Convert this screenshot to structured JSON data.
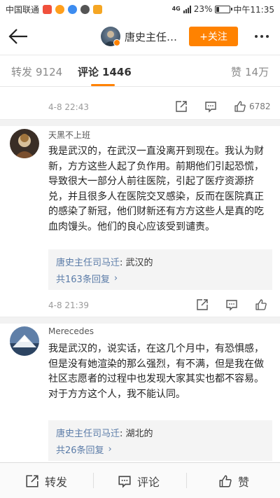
{
  "status_bar": {
    "carrier": "中国联通",
    "network": "4G",
    "battery_percent": "23%",
    "battery_level": 0.23,
    "time": "中午11:35"
  },
  "header": {
    "author_name": "唐史主任…",
    "follow_label": "+关注"
  },
  "tabs": {
    "repost_label": "转发",
    "repost_count": "9124",
    "comment_label": "评论",
    "comment_count": "1446",
    "like_label": "赞",
    "like_count": "14万"
  },
  "previous_comment_meta": {
    "time": "4-8 22:43",
    "like_count": "6782"
  },
  "comments": [
    {
      "username": "天黑不上班",
      "text": "我是武汉的，在武汉一直没离开到现在。我认为财新，方方这些人起了负作用。前期他们引起恐慌，导致很大一部分人前往医院，引起了医疗资源挤兑，并且很多人在医院交叉感染，反而在医院真正的感染了新冠，他们财新还有方方这些人是真的吃血肉馒头。他们的良心应该受到谴责。",
      "reply_author": "唐史主任司马迁",
      "reply_text": "武汉的",
      "reply_count_text": "共163条回复",
      "time": "4-8 21:39"
    },
    {
      "username": "Merecedes",
      "text": "我是武汉的，说实话，在这几个月中，有恐惧感，但是没有她渲染的那么强烈，有不满，但是我在做社区志愿者的过程中也发现大家其实也都不容易。对于方方这个人，我不能认同。",
      "reply_author": "唐史主任司马迁",
      "reply_text": "湖北的",
      "reply_count_text": "共26条回复"
    }
  ],
  "bottom_bar": {
    "repost_label": "转发",
    "comment_label": "评论",
    "like_label": "赞"
  },
  "colors": {
    "accent": "#ff8200",
    "link": "#5b7ca8"
  }
}
